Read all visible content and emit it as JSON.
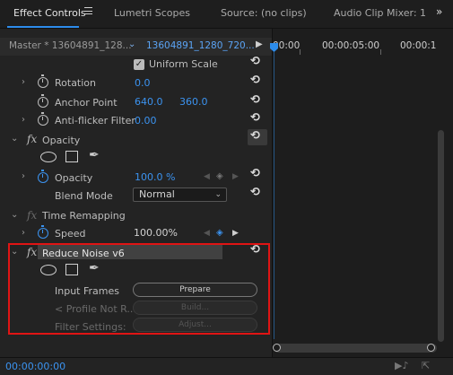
{
  "tabs": [
    {
      "label": "Effect Controls"
    },
    {
      "label": "Lumetri Scopes"
    },
    {
      "label": "Source: (no clips)"
    },
    {
      "label": "Audio Clip Mixer: 1"
    }
  ],
  "overflow_glyph": "»",
  "header": {
    "master_label": "Master * 13604891_128...",
    "clip_label": "13604891_1280_720..."
  },
  "ruler": {
    "labels": [
      "00:00",
      "00:00:05:00",
      "00:00:1"
    ]
  },
  "motion": {
    "uniform_scale_label": "Uniform Scale",
    "rotation_label": "Rotation",
    "rotation_value": "0.0",
    "anchor_label": "Anchor Point",
    "anchor_x": "640.0",
    "anchor_y": "360.0",
    "antiflicker_label": "Anti-flicker Filter",
    "antiflicker_value": "0.00"
  },
  "opacity": {
    "section_label": "Opacity",
    "opacity_label": "Opacity",
    "opacity_value": "100.0 %",
    "blend_label": "Blend Mode",
    "blend_value": "Normal"
  },
  "time_remap": {
    "section_label": "Time Remapping",
    "speed_label": "Speed",
    "speed_value": "100.00%"
  },
  "reduce_noise": {
    "section_label": "Reduce Noise v6",
    "input_frames_label": "Input Frames",
    "prepare_label": "Prepare",
    "profile_label": "< Profile Not R...",
    "build_label": "Build...",
    "filter_settings_label": "Filter Settings:",
    "adjust_label": "Adjust..."
  },
  "footer": {
    "timecode": "00:00:00:00"
  },
  "colors": {
    "accent_blue": "#3b93f0",
    "highlight_red": "#e01414",
    "panel_bg": "#232323"
  }
}
